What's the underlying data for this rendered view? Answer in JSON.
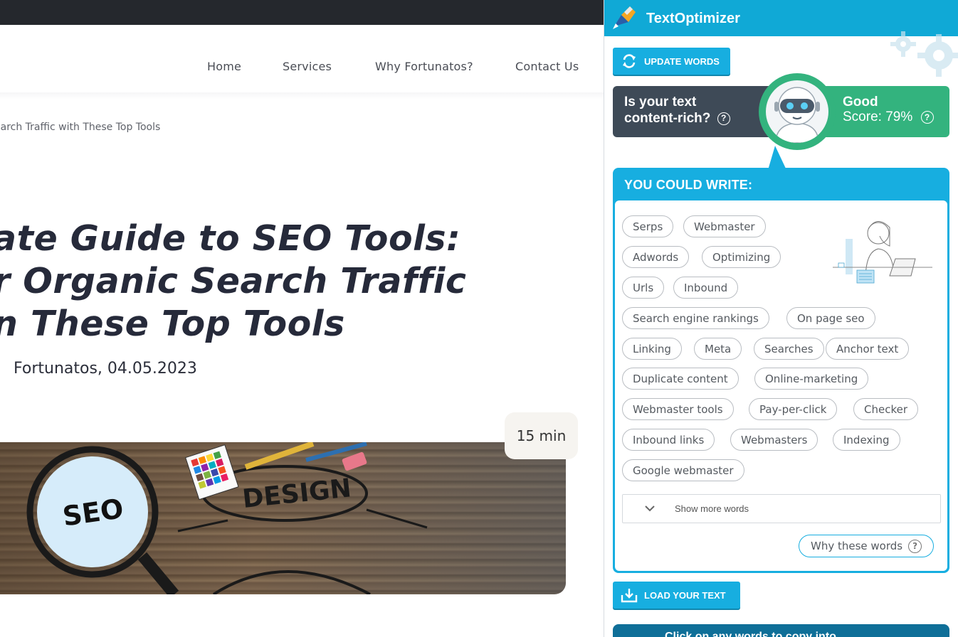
{
  "site": {
    "nav": [
      "Home",
      "Services",
      "Why Fortunatos?",
      "Contact Us"
    ],
    "breadcrumb": "earch Traffic with These Top Tools",
    "headline": [
      "ate Guide to SEO Tools:",
      "r Organic Search Traffic",
      "n These Top Tools"
    ],
    "author_date": "Fortunatos, 04.05.2023",
    "read_time": "15 min",
    "hero_words": [
      "SEO",
      "DESIGN"
    ]
  },
  "sidebar": {
    "title": "TextOptimizer",
    "update_button": "UPDATE WORDS",
    "score_question": "Is your text content-rich?",
    "score_label": "Good",
    "score_value": "Score: 79%",
    "could_write_title": "YOU COULD WRITE:",
    "words": [
      "Serps",
      "Webmaster",
      "Adwords",
      "Optimizing",
      "Urls",
      "Inbound",
      "Search engine rankings",
      "On page seo",
      "Linking",
      "Meta",
      "Searches",
      "Anchor text",
      "Duplicate content",
      "Online-marketing",
      "Webmaster tools",
      "Pay-per-click",
      "Checker",
      "Inbound links",
      "Webmasters",
      "Indexing",
      "Google webmaster"
    ],
    "show_more": "Show more words",
    "why_words": "Why these words",
    "load_button": "LOAD YOUR TEXT",
    "click_hint": "Click on any words to copy into",
    "colors": {
      "brand": "#10a9d6",
      "good": "#33b37e",
      "dark": "#3e4a57"
    }
  }
}
